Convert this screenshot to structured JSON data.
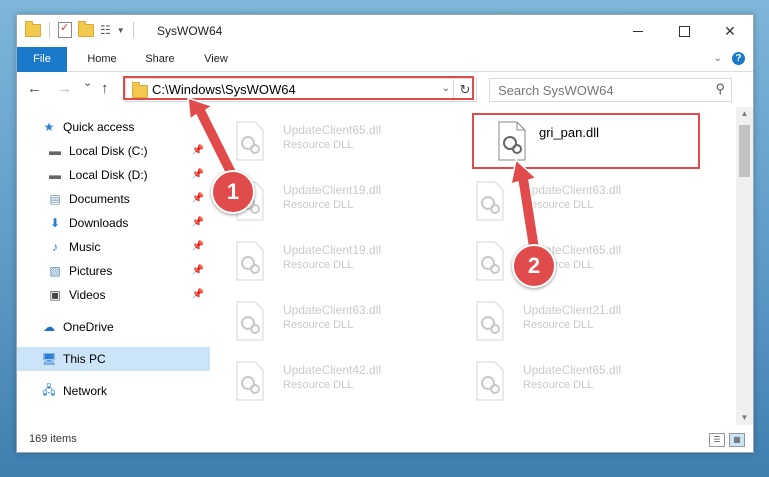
{
  "window": {
    "title": "SysWOW64",
    "minimize_label": "",
    "close_label": "✕"
  },
  "ribbon": {
    "tabs": [
      {
        "label": "File"
      },
      {
        "label": "Home"
      },
      {
        "label": "Share"
      },
      {
        "label": "View"
      }
    ]
  },
  "navbar": {
    "back_label": "←",
    "forward_label": "→",
    "recent_label": "⌄",
    "up_label": "↑",
    "address": "C:\\Windows\\SysWOW64",
    "search_placeholder": "Search SysWOW64"
  },
  "sidebar": {
    "items": [
      {
        "label": "Quick access",
        "icon": "star-icon",
        "pinned": false
      },
      {
        "label": "Local Disk (C:)",
        "icon": "drive-icon",
        "pinned": true
      },
      {
        "label": "Local Disk (D:)",
        "icon": "drive-icon",
        "pinned": true
      },
      {
        "label": "Documents",
        "icon": "documents-icon",
        "pinned": true
      },
      {
        "label": "Downloads",
        "icon": "download-icon",
        "pinned": true
      },
      {
        "label": "Music",
        "icon": "music-icon",
        "pinned": true
      },
      {
        "label": "Pictures",
        "icon": "pictures-icon",
        "pinned": true
      },
      {
        "label": "Videos",
        "icon": "videos-icon",
        "pinned": true
      },
      {
        "label": "OneDrive",
        "icon": "cloud-icon",
        "pinned": false
      },
      {
        "label": "This PC",
        "icon": "computer-icon",
        "pinned": false
      },
      {
        "label": "Network",
        "icon": "network-icon",
        "pinned": false
      }
    ]
  },
  "files": [
    {
      "name": "UpdateClient65.dll",
      "type": "Resource DLL"
    },
    {
      "name": "gri_pan.dll",
      "type": ""
    },
    {
      "name": "UpdateClient19.dll",
      "type": "Resource DLL"
    },
    {
      "name": "UpdateClient63.dll",
      "type": "Resource DLL"
    },
    {
      "name": "UpdateClient19.dll",
      "type": "Resource DLL"
    },
    {
      "name": "UpdateClient65.dll",
      "type": "Resource DLL"
    },
    {
      "name": "UpdateClient63.dll",
      "type": "Resource DLL"
    },
    {
      "name": "UpdateClient21.dll",
      "type": "Resource DLL"
    },
    {
      "name": "UpdateClient42.dll",
      "type": "Resource DLL"
    },
    {
      "name": "UpdateClient65.dll",
      "type": "Resource DLL"
    }
  ],
  "status": {
    "item_count": "169 items"
  },
  "callouts": [
    "1",
    "2"
  ],
  "colors": {
    "accent": "#1979ca",
    "highlight": "#e24b4b",
    "selected": "#cce4f7"
  }
}
